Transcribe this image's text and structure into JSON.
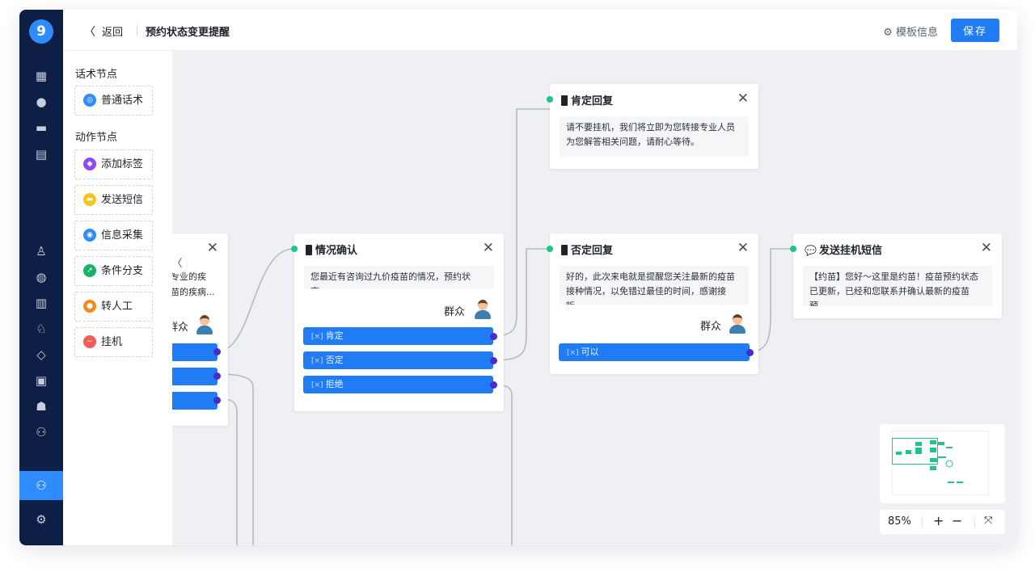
{
  "app": {
    "logo": "9"
  },
  "nav_rail": {
    "icons": [
      "dashboard-icon",
      "chat-icon",
      "message-icon",
      "clipboard-icon",
      "user-icon",
      "headset-icon",
      "bar-chart-icon",
      "group-icon",
      "shield-icon",
      "monitor-icon",
      "robot-icon",
      "bot-settings-icon",
      "flow-bot-icon",
      "settings-icon"
    ],
    "glyphs": [
      "▦",
      "●",
      "▬",
      "▤",
      "♙",
      "◍",
      "▥",
      "♘",
      "◇",
      "▣",
      "☗",
      "⚇",
      "⚇",
      "⚙"
    ],
    "active_index": 12
  },
  "topbar": {
    "back_label": "返回",
    "back_chevron": "〈",
    "title": "预约状态变更提醒",
    "template_info_label": "模板信息",
    "template_info_icon": "⚙",
    "save_label": "保存"
  },
  "palette": {
    "script_section": "话术节点",
    "action_section": "动作节点",
    "items": [
      {
        "label": "普通话术",
        "color": "#2f8cff",
        "glyph": "◎",
        "icon": "chat-bubble-icon"
      },
      {
        "label": "添加标签",
        "color": "#8e4cf0",
        "glyph": "◆",
        "icon": "tag-icon"
      },
      {
        "label": "发送短信",
        "color": "#f5c518",
        "glyph": "▬",
        "icon": "sms-icon"
      },
      {
        "label": "信息采集",
        "color": "#2f8cff",
        "glyph": "◉",
        "icon": "collect-icon"
      },
      {
        "label": "条件分支",
        "color": "#1ab26b",
        "glyph": "↗",
        "icon": "branch-icon"
      },
      {
        "label": "转人工",
        "color": "#f28a1c",
        "glyph": "●",
        "icon": "transfer-icon"
      },
      {
        "label": "挂机",
        "color": "#f45b5b",
        "glyph": "−",
        "icon": "hangup-icon"
      }
    ]
  },
  "canvas": {
    "partial_node": {
      "close": "✕",
      "text_line1": "专业的疾",
      "text_line2": "苗的疾病...",
      "role": "群众",
      "collapse": "〈"
    },
    "node_confirm": {
      "title": "情况确认",
      "close": "✕",
      "text": "您最近有咨询过九价疫苗的情况，预约状态...",
      "role": "群众",
      "options": [
        "肯定",
        "否定",
        "拒绝"
      ]
    },
    "node_positive": {
      "title": "肯定回复",
      "close": "✕",
      "text": "请不要挂机，我们将立即为您转接专业人员为您解答相关问题，请耐心等待。"
    },
    "node_negative": {
      "title": "否定回复",
      "close": "✕",
      "text": "好的，此次来电就是提醒您关注最新的疫苗接种情况，以免错过最佳的时间，感谢接听...",
      "role": "群众",
      "options": [
        "可以"
      ]
    },
    "node_sms": {
      "title": "发送挂机短信",
      "close": "✕",
      "icon": "💬",
      "text": "【约苗】您好～这里是约苗！疫苗预约状态已更新，已经和您联系并确认最新的疫苗预..."
    }
  },
  "zoom": {
    "level": "85%",
    "zoom_in": "+",
    "zoom_out": "−",
    "fit": "⤧"
  },
  "colors": {
    "accent": "#1f7cf4",
    "rail": "#0e1f45",
    "port": "#4a2bd1",
    "in_port": "#1ec48d"
  }
}
